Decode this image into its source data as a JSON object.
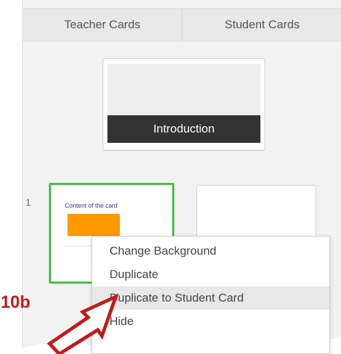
{
  "tabs": [
    {
      "label": "Teacher Cards"
    },
    {
      "label": "Student Cards"
    }
  ],
  "intro_card": {
    "title": "Introduction"
  },
  "row": {
    "number": "1"
  },
  "content_card": {
    "title": "Content of the card",
    "accent_color": "#ff9900",
    "selected_border_color": "#3cc43c",
    "icon": "bookmark-icon"
  },
  "context_menu": {
    "items": [
      {
        "label": "Change Background"
      },
      {
        "label": "Duplicate"
      },
      {
        "label": "Duplicate to Student Card"
      },
      {
        "label": "Hide"
      }
    ],
    "highlighted_index": 2
  },
  "annotation": {
    "label": "10b",
    "color": "#c31a1a"
  }
}
